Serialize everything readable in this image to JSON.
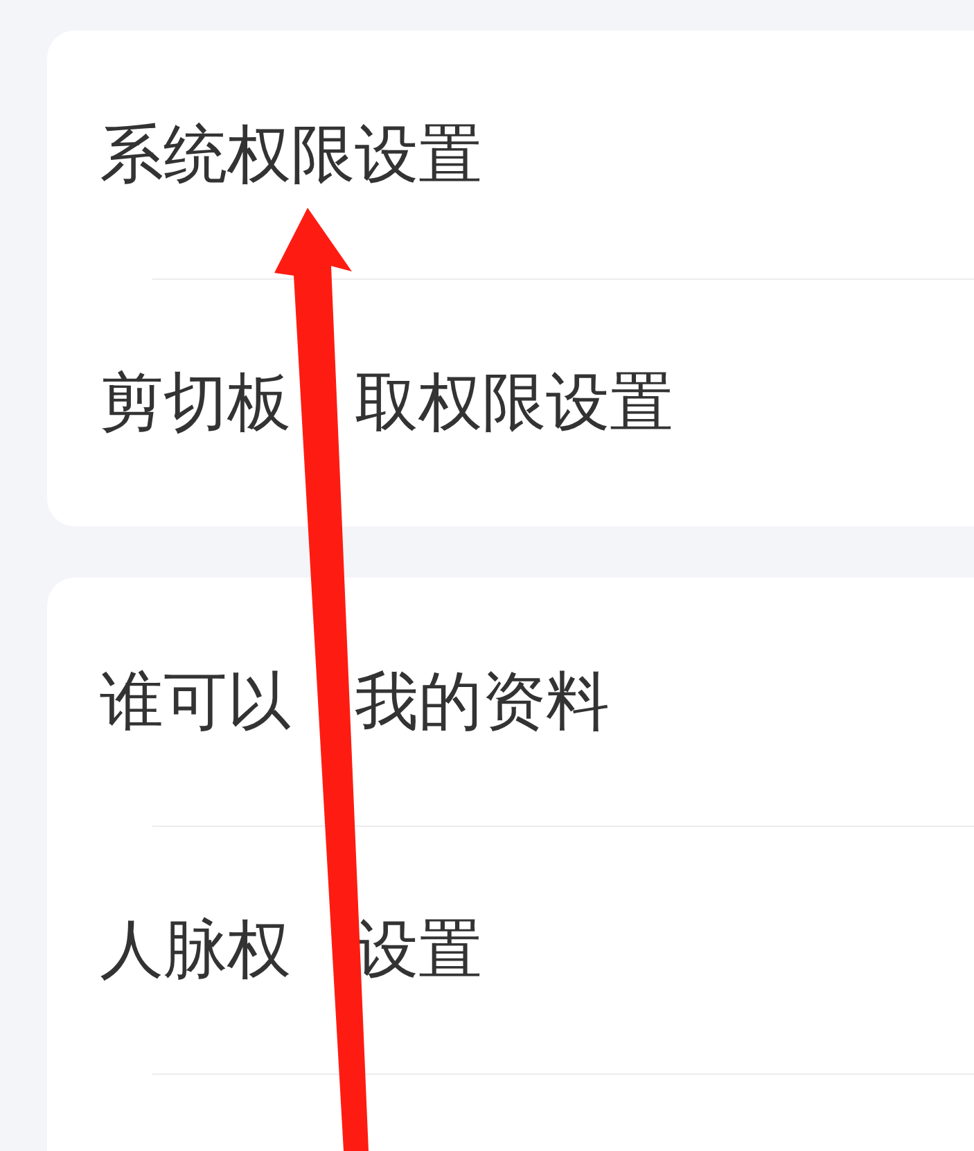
{
  "cards": [
    {
      "items": [
        {
          "label_parts": [
            "系统权限设置"
          ]
        },
        {
          "label_parts": [
            "剪切板",
            "取权限设置"
          ]
        }
      ]
    },
    {
      "items": [
        {
          "label_parts": [
            "谁可以",
            "我的资料"
          ]
        },
        {
          "label_parts": [
            "人脉权",
            "设置"
          ]
        }
      ]
    }
  ]
}
